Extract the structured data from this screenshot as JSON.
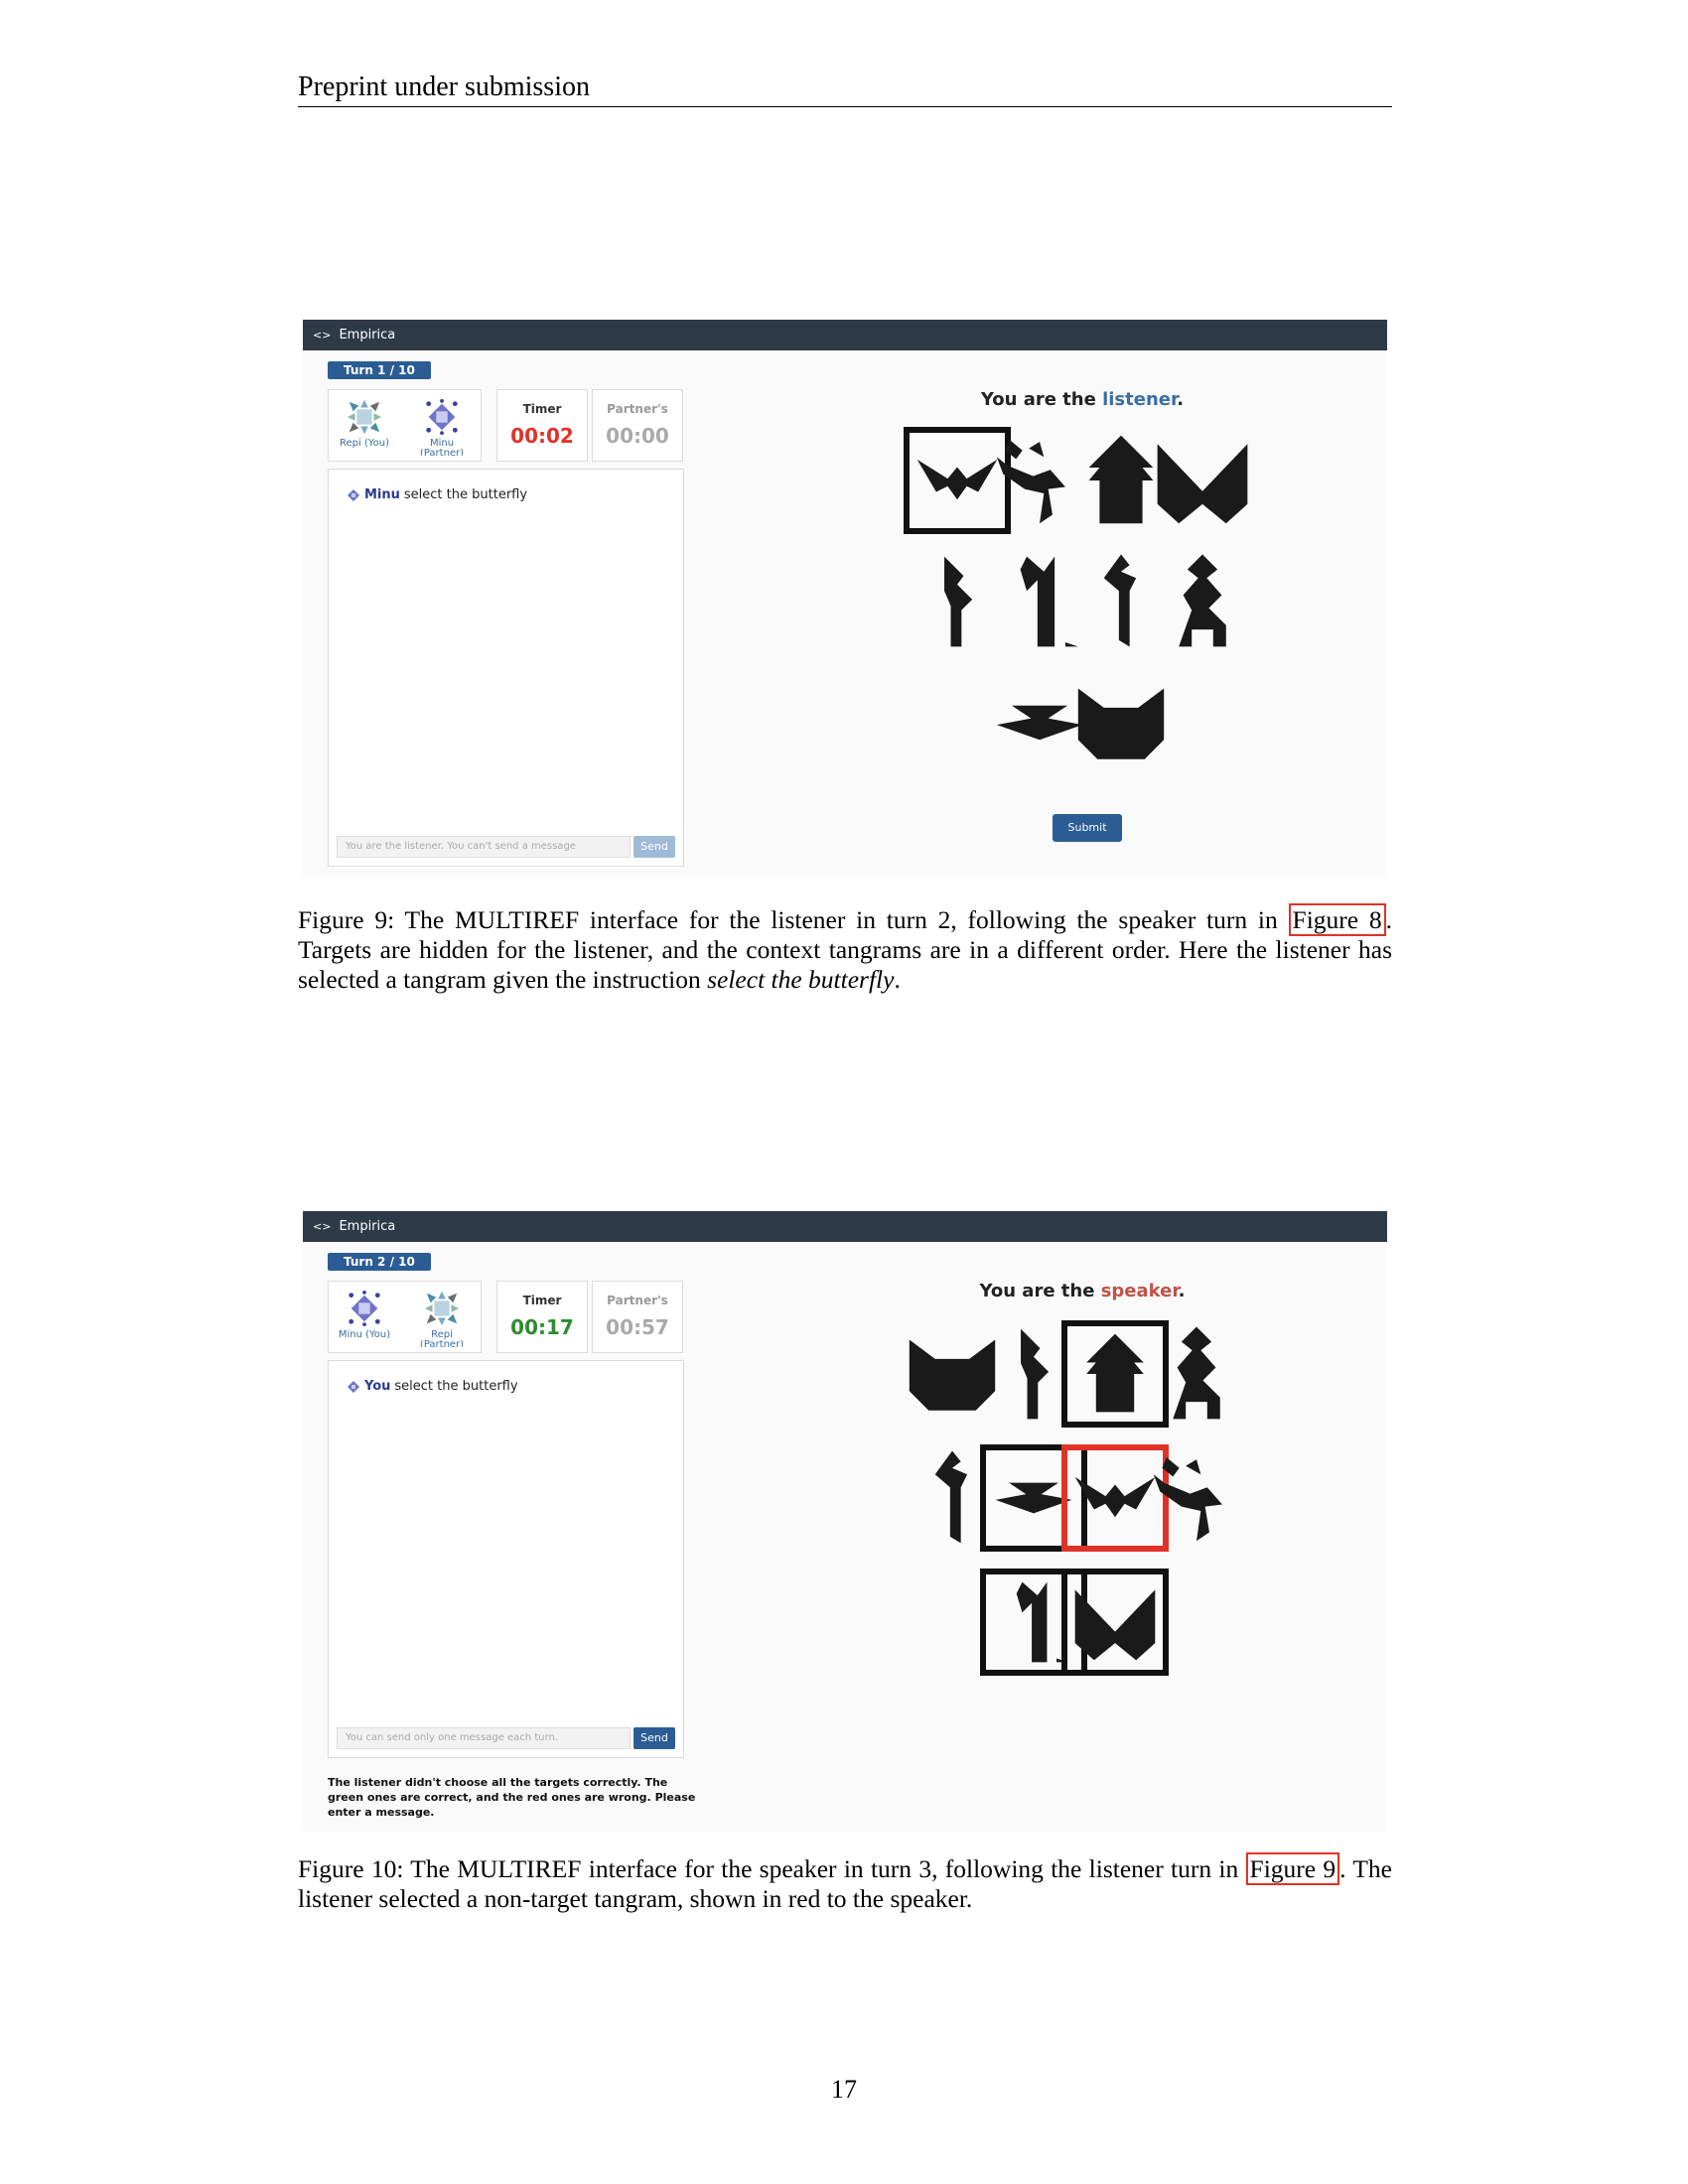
{
  "page": {
    "header": "Preprint under submission",
    "number": "17"
  },
  "app": {
    "brand": "Empirica"
  },
  "fig9": {
    "turn": "Turn 1 / 10",
    "player1": "Repi (You)",
    "player2": "Minu",
    "player2_sub": "(Partner)",
    "timer_label": "Timer",
    "timer_value": "00:02",
    "partner_label": "Partner's",
    "partner_value": "00:00",
    "chat_name": "Minu",
    "chat_text": "select the butterfly",
    "input_placeholder": "You are the listener. You can't send a message",
    "send": "Send",
    "role_prefix": "You are the ",
    "role": "listener",
    "role_suffix": ".",
    "submit": "Submit",
    "tiles": [
      "butterfly-bat",
      "kneeling-figure",
      "house",
      "bowtie",
      "narrow-figure",
      "tall-figure",
      "slim-figure",
      "standing-figure",
      "boat",
      "cat-head"
    ],
    "selected": [
      "butterfly-bat"
    ]
  },
  "fig10": {
    "turn": "Turn 2 / 10",
    "player1": "Minu (You)",
    "player2": "Repi",
    "player2_sub": "(Partner)",
    "timer_label": "Timer",
    "timer_value": "00:17",
    "partner_label": "Partner's",
    "partner_value": "00:57",
    "chat_name": "You",
    "chat_text": "select the butterfly",
    "input_placeholder": "You can send only one message each turn.",
    "send": "Send",
    "feedback": "The listener didn't choose all the targets correctly. The green ones are correct, and the red ones are wrong. Please enter a message.",
    "role_prefix": "You are the ",
    "role": "speaker",
    "role_suffix": ".",
    "tiles": [
      "cat-head",
      "narrow-figure",
      "house",
      "standing-figure",
      "slim-figure",
      "boat",
      "butterfly-bat",
      "kneeling-figure",
      "tall-figure",
      "bowtie"
    ],
    "selected": [
      "house",
      "boat",
      "tall-figure",
      "bowtie"
    ],
    "wrong": [
      "butterfly-bat"
    ]
  },
  "captions": {
    "fig9": {
      "prefix": "Figure 9: The ",
      "m": "M",
      "ulti": "ULTI",
      "r": "R",
      "ef": "EF",
      "mid": " interface for the listener in turn 2, following the speaker turn in ",
      "ref": "Figure 8",
      "rest": ". Targets are hidden for the listener, and the context tangrams are in a different order. Here the listener has selected a tangram given the instruction ",
      "italic": "select the butterfly",
      "end": "."
    },
    "fig10": {
      "prefix": "Figure 10: The ",
      "m": "M",
      "ulti": "ULTI",
      "r": "R",
      "ef": "EF",
      "mid": " interface for the speaker in turn 3, following the listener turn in ",
      "ref": "Figure 9",
      "rest": ". The listener selected a non-target tangram, shown in red to the speaker."
    }
  }
}
